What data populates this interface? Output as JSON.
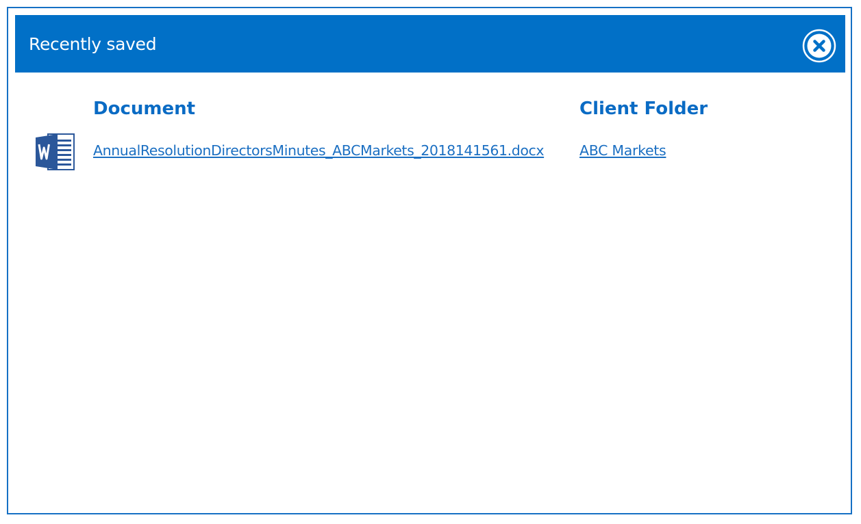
{
  "dialog": {
    "title": "Recently saved",
    "close_icon": "close-circle-icon"
  },
  "table": {
    "headers": {
      "document": "Document",
      "client_folder": "Client Folder"
    },
    "rows": [
      {
        "icon": "word-document-icon",
        "document": "AnnualResolutionDirectorsMinutes_ABCMarkets_2018141561.docx",
        "client_folder": "ABC Markets"
      }
    ]
  },
  "colors": {
    "titlebar": "#0170c7",
    "border": "#1570c4",
    "header_text": "#0a6bc4",
    "link": "#1b6fc2",
    "word_blue": "#2b579a"
  }
}
